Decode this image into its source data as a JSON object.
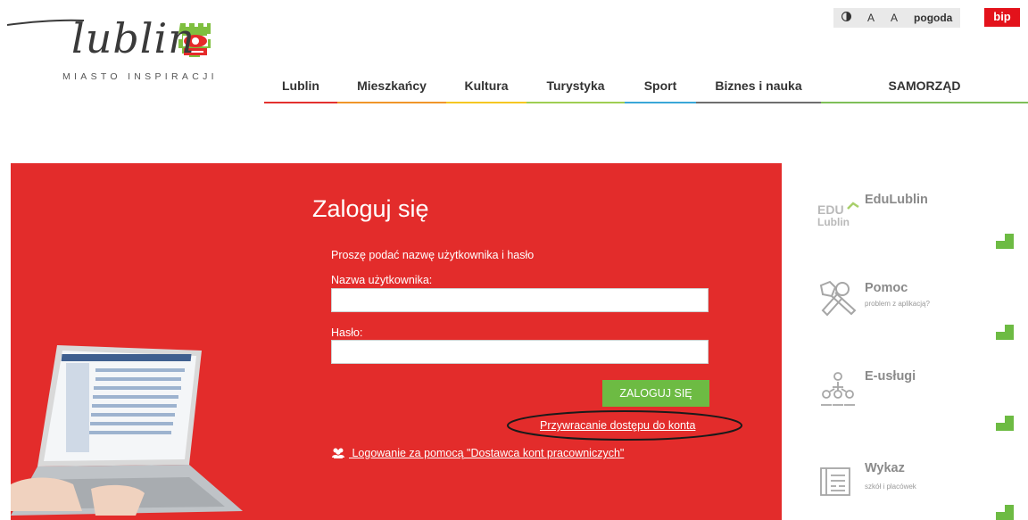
{
  "logo": {
    "wordmark": "lublin",
    "tagline": "MIASTO INSPIRACJI"
  },
  "utility": {
    "contrast_icon": "contrast-icon",
    "font_a1": "A",
    "font_a2": "A",
    "weather": "pogoda",
    "bip": "bip"
  },
  "nav": [
    {
      "label": "Lublin",
      "color": "#e3312e"
    },
    {
      "label": "Mieszkańcy",
      "color": "#f0962a"
    },
    {
      "label": "Kultura",
      "color": "#f5c722"
    },
    {
      "label": "Turystyka",
      "color": "#9fce52"
    },
    {
      "label": "Sport",
      "color": "#3aa7d8"
    },
    {
      "label": "Biznes i nauka",
      "color": "#6f6f6f"
    },
    {
      "label": "SAMORZĄD",
      "color": "#7fbf58"
    }
  ],
  "login": {
    "title": "Zaloguj się",
    "prompt": "Proszę podać nazwę użytkownika i hasło",
    "username_label": "Nazwa użytkownika:",
    "password_label": "Hasło:",
    "username_value": "",
    "password_value": "",
    "submit_label": "ZALOGUJ SIĘ",
    "recover_link": "Przywracanie dostępu do konta",
    "provider_link": " Logowanie za pomocą \"Dostawca kont pracowniczych\""
  },
  "sidebar": [
    {
      "icon": "edulublin-logo-icon",
      "logo_top": "EDU",
      "logo_bottom": "Lublin",
      "title": "EduLublin",
      "subtitle": ""
    },
    {
      "icon": "tools-icon",
      "title": "Pomoc",
      "subtitle": "problem z aplikacją?"
    },
    {
      "icon": "people-network-icon",
      "title": "E-usługi",
      "subtitle": ""
    },
    {
      "icon": "document-list-icon",
      "title": "Wykaz",
      "subtitle": "szkół i placówek"
    }
  ],
  "colors": {
    "panel_red": "#e32c2b",
    "button_green": "#6dbb43",
    "bip_red": "#e3121b",
    "corner_green": "#6dbb43"
  }
}
